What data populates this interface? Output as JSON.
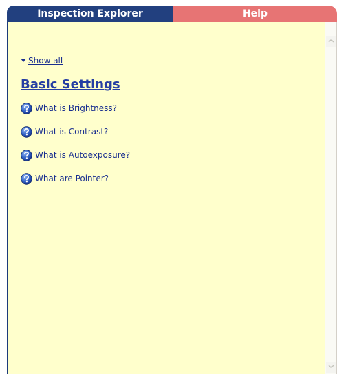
{
  "tabs": {
    "inspection_label": "Inspection Explorer",
    "help_label": "Help"
  },
  "help": {
    "show_all_label": "Show all",
    "section_title": "Basic Settings",
    "questions": [
      "What is Brightness?",
      "What is Contrast?",
      "What is Autoexposure?",
      "What are Pointer?"
    ]
  },
  "colors": {
    "inspection_tab": "#22407f",
    "help_tab": "#e77474",
    "panel_background": "#ffffcc",
    "link": "#1a2f8f"
  },
  "icons": {
    "question": "help-question-icon",
    "show_all": "triangle-down-icon",
    "scroll_up": "chevron-up-icon",
    "scroll_down": "chevron-down-icon"
  }
}
